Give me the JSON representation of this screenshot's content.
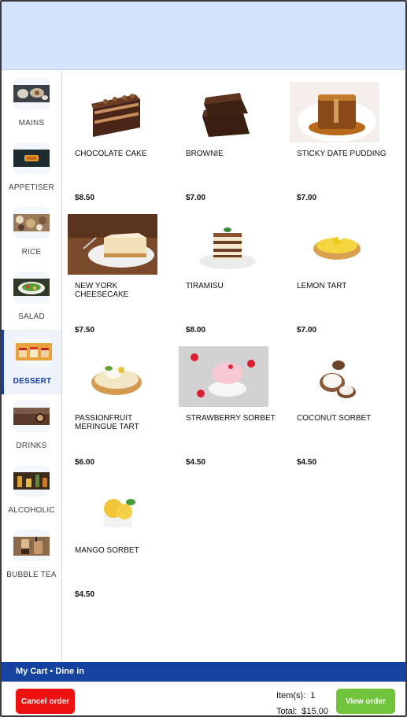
{
  "sidebar": {
    "categories": [
      {
        "label": "MAINS",
        "icon": "mains-thumbnail"
      },
      {
        "label": "APPETISER",
        "icon": "appetiser-thumbnail"
      },
      {
        "label": "RICE",
        "icon": "rice-thumbnail"
      },
      {
        "label": "SALAD",
        "icon": "salad-thumbnail"
      },
      {
        "label": "DESSERT",
        "icon": "dessert-thumbnail",
        "active": true
      },
      {
        "label": "DRINKS",
        "icon": "drinks-thumbnail"
      },
      {
        "label": "ALCOHOLIC",
        "icon": "alcoholic-thumbnail"
      },
      {
        "label": "BUBBLE TEA",
        "icon": "bubble-tea-thumbnail"
      }
    ]
  },
  "menu": {
    "items": [
      {
        "name": "CHOCOLATE CAKE",
        "price": "$8.50"
      },
      {
        "name": "BROWNIE",
        "price": "$7.00"
      },
      {
        "name": "STICKY DATE PUDDING",
        "price": "$7.00"
      },
      {
        "name": "NEW YORK CHEESECAKE",
        "price": "$7.50"
      },
      {
        "name": "TIRAMISU",
        "price": "$8.00"
      },
      {
        "name": "LEMON TART",
        "price": "$7.00"
      },
      {
        "name": "PASSIONFRUIT MERINGUE TART",
        "price": "$6.00"
      },
      {
        "name": "STRAWBERRY SORBET",
        "price": "$4.50"
      },
      {
        "name": "COCONUT SORBET",
        "price": "$4.50"
      },
      {
        "name": "MANGO SORBET",
        "price": "$4.50"
      }
    ]
  },
  "cart": {
    "title": "My Cart • Dine in",
    "items_label": "Item(s):",
    "items_count": "1",
    "total_label": "Total:",
    "total_value": "$15.00"
  },
  "actions": {
    "cancel_label": "Cancel order",
    "view_label": "View order"
  },
  "colors": {
    "banner": "#d4e3fb",
    "accent": "#1642a0",
    "cancel": "#ee1111",
    "view": "#6fc43c"
  }
}
